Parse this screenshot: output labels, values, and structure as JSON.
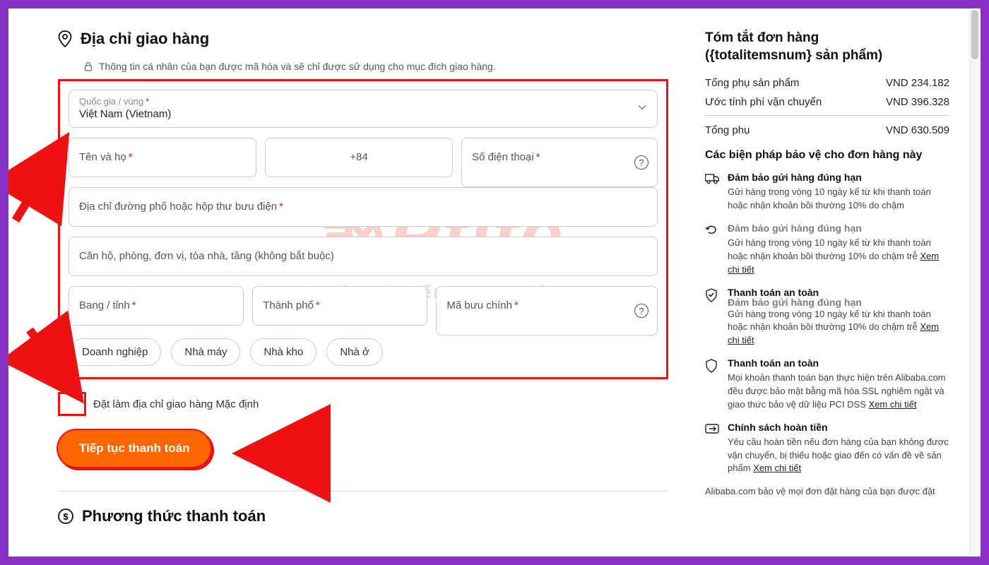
{
  "shipping": {
    "title": "Địa chỉ giao hàng",
    "privacy_note": "Thông tin cá nhân của bạn được mã hóa và sẽ chỉ được sử dụng cho mục đích giao hàng.",
    "country_label": "Quốc gia / vùng",
    "country_value": "Việt Nam (Vietnam)",
    "fullname_label": "Tên và họ",
    "phone_prefix": "+84",
    "phone_label": "Số điện thoại",
    "street_label": "Địa chỉ đường phố hoặc hộp thư bưu điện",
    "apartment_label": "Căn hộ, phòng, đơn vị, tòa nhà, tầng (không bắt buộc)",
    "state_label": "Bang / tỉnh",
    "city_label": "Thành phố",
    "postal_label": "Mã bưu chính",
    "chips": {
      "business": "Doanh nghiệp",
      "factory": "Nhà máy",
      "warehouse": "Nhà kho",
      "home": "Nhà ở"
    },
    "default_checkbox_label": "Đặt làm địa chỉ giao hàng Mặc định",
    "continue_button": "Tiếp tục thanh toán"
  },
  "payment": {
    "title": "Phương thức thanh toán"
  },
  "summary": {
    "title_line1": "Tóm tắt đơn hàng",
    "title_line2": "({totalitemsnum} sản phẩm)",
    "subtotal_label": "Tổng phụ sản phẩm",
    "subtotal_value": "VND 234.182",
    "shipping_label": "Ước tính phí vận chuyển",
    "shipping_value": "VND 396.328",
    "total_label": "Tổng phụ",
    "total_value": "VND 630.509"
  },
  "protection": {
    "heading": "Các biện pháp bảo vệ cho đơn hàng này",
    "items": [
      {
        "icon": "truck",
        "title": "Đảm bảo gửi hàng đúng hạn",
        "desc": "Gửi hàng trong vòng 10 ngày kể từ khi thanh toán hoặc nhận khoản bồi thường 10% do chậm",
        "link": ""
      },
      {
        "icon": "return-ghost",
        "ghost_title": "Đảm bảo gửi hàng đúng hạn",
        "desc": "Gửi hàng trong vòng 10 ngày kể từ khi thanh toán hoặc nhận khoản bồi thường 10% do chậm trễ",
        "link": "Xem chi tiết"
      },
      {
        "icon": "shield-check",
        "title": "Thanh toán an toàn",
        "ghost_title": "Đảm bảo gửi hàng đúng hạn",
        "desc": "Gửi hàng trong vòng 10 ngày kể từ khi thanh toán hoặc nhận khoản bồi thường 10% do chậm trễ",
        "link": "Xem chi tiết"
      },
      {
        "icon": "shield",
        "title": "Thanh toán an toàn",
        "desc": "Mọi khoản thanh toán bạn thực hiện trên Alibaba.com đều được bảo mật bằng mã hóa SSL nghiêm ngặt và giao thức bảo vệ dữ liệu PCI DSS",
        "link": "Xem chi tiết"
      },
      {
        "icon": "refund",
        "title": "Chính sách hoàn tiền",
        "desc": "Yêu cầu hoàn tiền nếu đơn hàng của bạn không được vận chuyển, bị thiếu hoặc giao đến có vấn đề về sản phẩm",
        "link": "Xem chi tiết"
      }
    ],
    "footnote": "Alibaba.com bảo vệ mọi đơn đặt hàng của bạn được đặt"
  },
  "watermark": {
    "brand": "Ptite",
    "tagline": "Vận Chuyển Trung Việt"
  }
}
